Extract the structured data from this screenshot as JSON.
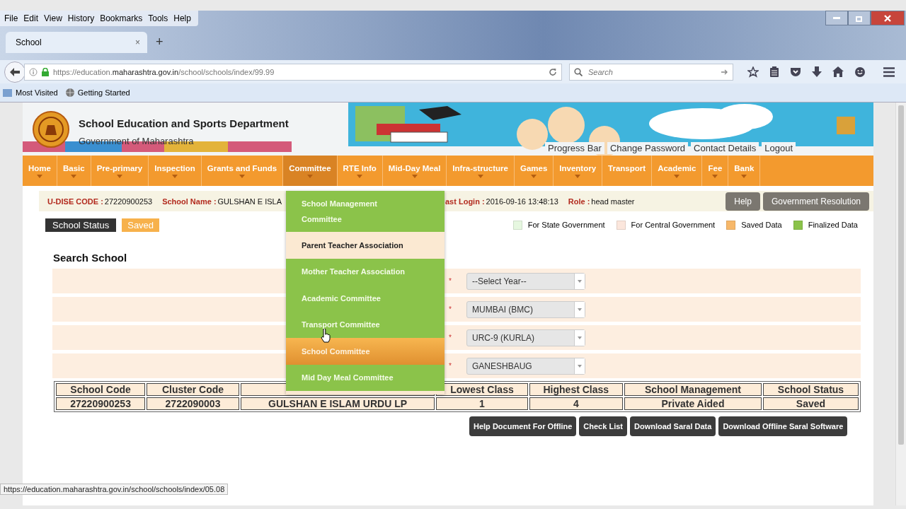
{
  "menu_bar": [
    "File",
    "Edit",
    "View",
    "History",
    "Bookmarks",
    "Tools",
    "Help"
  ],
  "tabs": [
    {
      "label": "School",
      "selected": true,
      "close": "×"
    }
  ],
  "new_tab": "+",
  "address_bar": {
    "url": "https://education.**maharashtra.gov.in**/school/schools/index/99.99"
  },
  "search": {
    "placeholder": "Search"
  },
  "bookmarks": [
    "Most Visited",
    "Getting Started"
  ],
  "header": {
    "title": "School Education and Sports Department",
    "subtitle": "Government of Maharashtra",
    "links": [
      "Progress Bar",
      "Change Password",
      "Contact Details",
      "Logout"
    ]
  },
  "nav": [
    {
      "label": "Home",
      "selected": false,
      "has_submenu": true
    },
    {
      "label": "Basic",
      "selected": false,
      "has_submenu": true
    },
    {
      "label": "Pre-primary",
      "selected": false,
      "has_submenu": true
    },
    {
      "label": "Inspection",
      "selected": false,
      "has_submenu": true
    },
    {
      "label": "Grants and Funds",
      "selected": false,
      "has_submenu": true
    },
    {
      "label": "Committee",
      "selected": true,
      "has_submenu": true
    },
    {
      "label": "RTE Info",
      "selected": false,
      "has_submenu": true
    },
    {
      "label": "Mid-Day Meal",
      "selected": false,
      "has_submenu": true
    },
    {
      "label": "Infra-structure",
      "selected": false,
      "has_submenu": true
    },
    {
      "label": "Games",
      "selected": false,
      "has_submenu": true
    },
    {
      "label": "Inventory",
      "selected": false,
      "has_submenu": true
    },
    {
      "label": "Transport",
      "selected": false,
      "has_submenu": false
    },
    {
      "label": "Academic",
      "selected": false,
      "has_submenu": true
    },
    {
      "label": "Fee",
      "selected": false,
      "has_submenu": true
    },
    {
      "label": "Bank",
      "selected": false,
      "has_submenu": true
    }
  ],
  "committee_menu": [
    {
      "label": "School Management Committee",
      "kind": "plain"
    },
    {
      "label": "Parent Teacher Association",
      "kind": "current"
    },
    {
      "label": "Mother Teacher Association",
      "kind": "plain"
    },
    {
      "label": "Academic Committee",
      "kind": "plain"
    },
    {
      "label": "Transport Committee",
      "kind": "plain"
    },
    {
      "label": "School Committee",
      "kind": "hover"
    },
    {
      "label": "Mid Day Meal Committee",
      "kind": "plain"
    }
  ],
  "info_bar": {
    "fields": [
      {
        "label": "U-DISE CODE :",
        "value": "27220900253"
      },
      {
        "label": "School Name :",
        "value": "GULSHAN E ISLA"
      },
      {
        "label": "ast Login :",
        "value": "2016-09-16 13:48:13"
      },
      {
        "label": "Role :",
        "value": "head master"
      }
    ],
    "buttons": [
      "Help",
      "Government Resolution"
    ]
  },
  "school_status": {
    "label": "School Status",
    "value": "Saved"
  },
  "legend": [
    {
      "label": "For State Government",
      "color": "#e6f7e0"
    },
    {
      "label": "For Central Government",
      "color": "#fbe6dc"
    },
    {
      "label": "Saved Data",
      "color": "#f7b86a"
    },
    {
      "label": "Finalized Data",
      "color": "#8bc34a"
    }
  ],
  "search_school": {
    "title": "Search School",
    "rows": [
      {
        "required_mark": "*",
        "value": "--Select Year--"
      },
      {
        "required_mark": "*",
        "value": "MUMBAI (BMC)"
      },
      {
        "required_mark": "*",
        "value": "URC-9 (KURLA)"
      },
      {
        "required_mark": "*",
        "value": "GANESHBAUG"
      }
    ]
  },
  "table": {
    "columns": [
      "School Code",
      "Cluster Code",
      "",
      "Lowest Class",
      "Highest Class",
      "School Management",
      "School Status"
    ],
    "rows": [
      [
        "27220900253",
        "2722090003",
        "GULSHAN E ISLAM URDU LP",
        "1",
        "4",
        "Private Aided",
        "Saved"
      ]
    ]
  },
  "actions": [
    "Help Document For Offline",
    "Check List",
    "Download Saral Data",
    "Download Offline Saral Software"
  ],
  "status_bar": "https://education.maharashtra.gov.in/school/schools/index/05.08"
}
